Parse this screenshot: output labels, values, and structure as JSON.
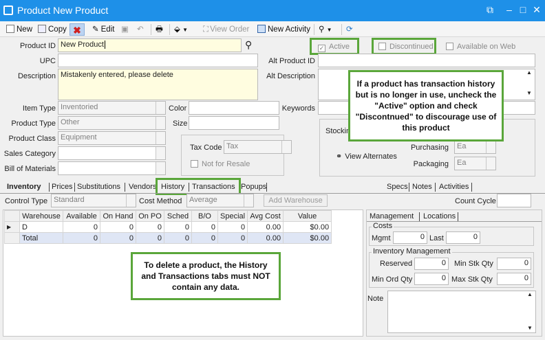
{
  "window": {
    "title": "Product New Product"
  },
  "toolbar": {
    "new": "New",
    "copy": "Copy",
    "edit": "Edit",
    "view_order": "View Order",
    "new_activity": "New Activity"
  },
  "colors": {
    "titlebar": "#1e90e8",
    "highlight": "#5aa63a",
    "field_yellow": "#fffde0",
    "total_row": "#dfe6f5"
  },
  "form": {
    "product_id_label": "Product ID",
    "product_id": "New Product",
    "upc_label": "UPC",
    "upc": "",
    "description_label": "Description",
    "description": "Mistakenly entered, please delete",
    "item_type_label": "Item Type",
    "item_type": "Inventoried",
    "product_type_label": "Product Type",
    "product_type": "Other",
    "product_class_label": "Product Class",
    "product_class": "Equipment",
    "sales_category_label": "Sales Category",
    "sales_category": "",
    "bom_label": "Bill of Materials",
    "bom": "",
    "color_label": "Color",
    "size_label": "Size",
    "tax_code_label": "Tax Code",
    "tax_code": "Tax",
    "not_for_resale": "Not for Resale",
    "active": "Active",
    "discontinued": "Discontinued",
    "available_on_web": "Available on Web",
    "alt_product_id_label": "Alt Product ID",
    "alt_description_label": "Alt Description",
    "keywords_label": "Keywords",
    "stocking_label": "Stockin",
    "view_alternates": "View Alternates",
    "purchasing_label": "Purchasing",
    "purchasing": "Ea",
    "packaging_label": "Packaging",
    "packaging": "Ea"
  },
  "tabs": {
    "main": [
      "Inventory",
      "Prices",
      "Substitutions",
      "Vendors",
      "History",
      "Transactions",
      "Popups"
    ],
    "right": [
      "Specs",
      "Notes",
      "Activities"
    ]
  },
  "inventory": {
    "control_type_label": "Control Type",
    "control_type": "Standard",
    "cost_method_label": "Cost Method",
    "cost_method": "Average",
    "add_warehouse": "Add Warehouse",
    "cycle_count_label": "Count Cycle",
    "columns": [
      "Warehouse",
      "Available",
      "On Hand",
      "On PO",
      "Sched",
      "B/O",
      "Special",
      "Avg Cost",
      "Value"
    ],
    "rows": [
      [
        "D",
        "0",
        "0",
        "0",
        "0",
        "0",
        "0",
        "0.00",
        "$0.00"
      ],
      [
        "Total",
        "0",
        "0",
        "0",
        "0",
        "0",
        "0",
        "0.00",
        "$0.00"
      ]
    ]
  },
  "right_panel": {
    "tabs": [
      "Management",
      "Locations"
    ],
    "costs_label": "Costs",
    "mgmt_label": "Mgmt",
    "mgmt": "0",
    "last_label": "Last",
    "last": "0",
    "inv_mgmt_label": "Inventory Management",
    "reserved_label": "Reserved",
    "reserved": "0",
    "min_stk_label": "Min Stk Qty",
    "min_stk": "0",
    "min_ord_label": "Min Ord Qty",
    "min_ord": "0",
    "max_stk_label": "Max Stk Qty",
    "max_stk": "0",
    "note_label": "Note"
  },
  "callouts": {
    "top": "If a product has transaction history but is no longer in use, uncheck the \"Active\" option and check \"Discontnued\" to discourage use of this product",
    "bottom": "To delete a product, the History and Transactions tabs must NOT contain any data."
  }
}
